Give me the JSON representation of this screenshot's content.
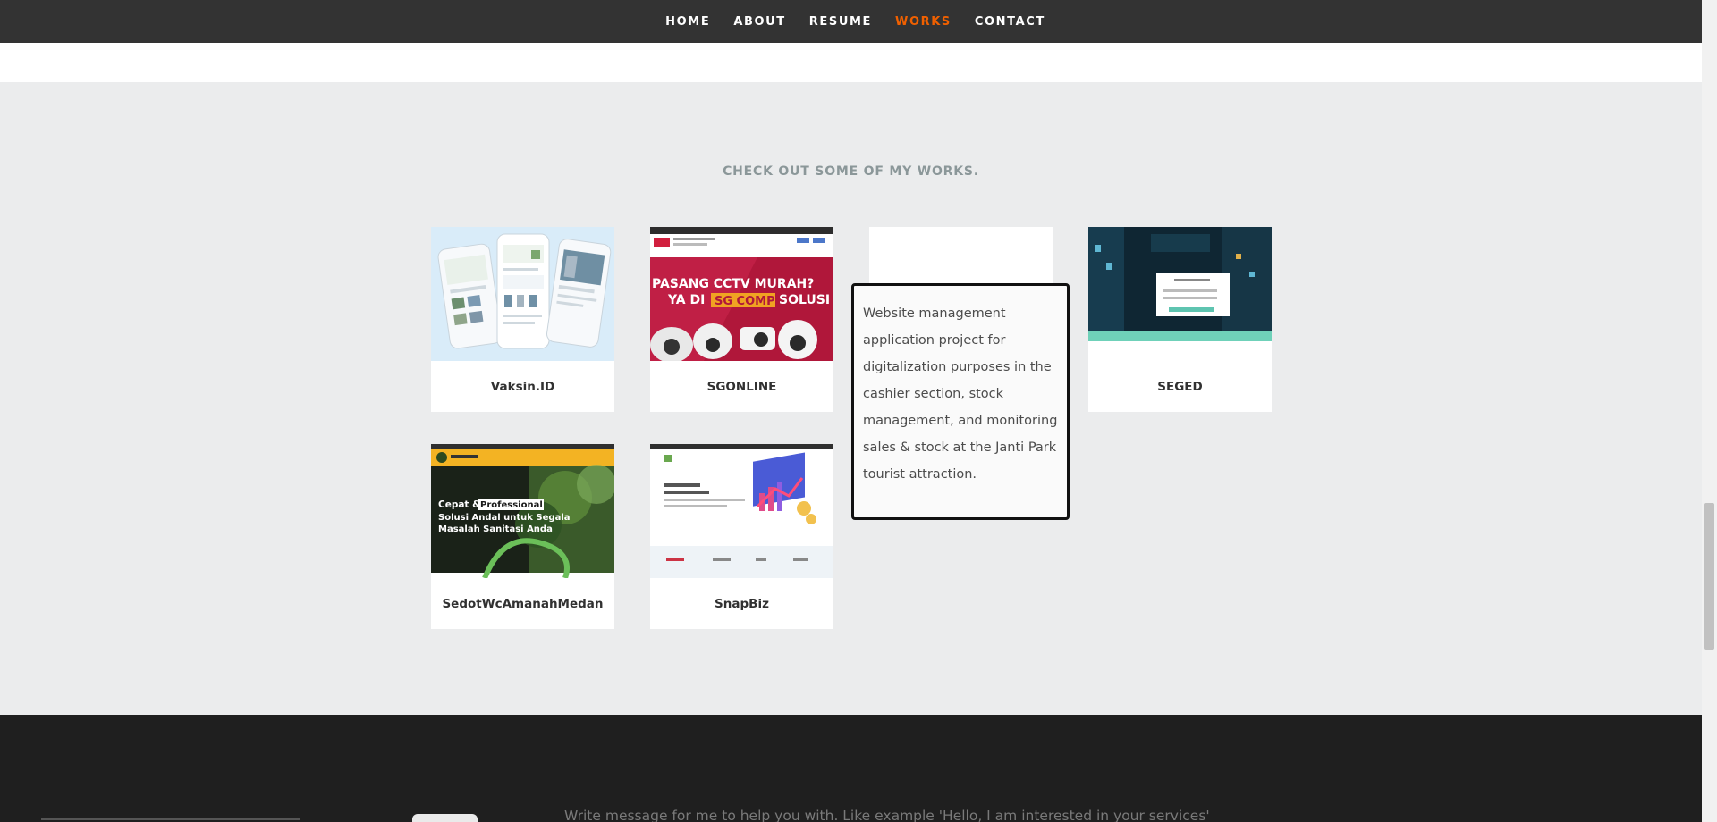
{
  "nav": {
    "items": [
      {
        "label": "HOME",
        "active": false
      },
      {
        "label": "ABOUT",
        "active": false
      },
      {
        "label": "RESUME",
        "active": false
      },
      {
        "label": "WORKS",
        "active": true
      },
      {
        "label": "CONTACT",
        "active": false
      }
    ],
    "accent": "#f06000"
  },
  "works": {
    "title": "CHECK OUT SOME OF MY WORKS.",
    "cards": [
      {
        "label": "Vaksin.ID"
      },
      {
        "label": "SGONLINE"
      },
      {
        "label": "SEGED"
      },
      {
        "label": "SedotWcAmanahMedan"
      },
      {
        "label": "SnapBiz"
      }
    ],
    "hover_description": "Website management application project for digitalization purposes in the cashier section, stock management, and monitoring sales & stock at the Janti Park tourist attraction."
  },
  "thumbs": {
    "sgonline_headline_1": "PASANG CCTV MURAH?",
    "sgonline_headline_2": "YA DI",
    "sgonline_brand": "SG COMP",
    "sgonline_tail": "SOLUSI",
    "sedot_line_1": "Cepat &",
    "sedot_badge": "Professional",
    "sedot_line_2": "Solusi Andal untuk Segala",
    "sedot_line_3": "Masalah Sanitasi Anda"
  },
  "footer": {
    "message_placeholder": "Write message for me to help you with. Like example 'Hello, I am interested in your services'"
  }
}
